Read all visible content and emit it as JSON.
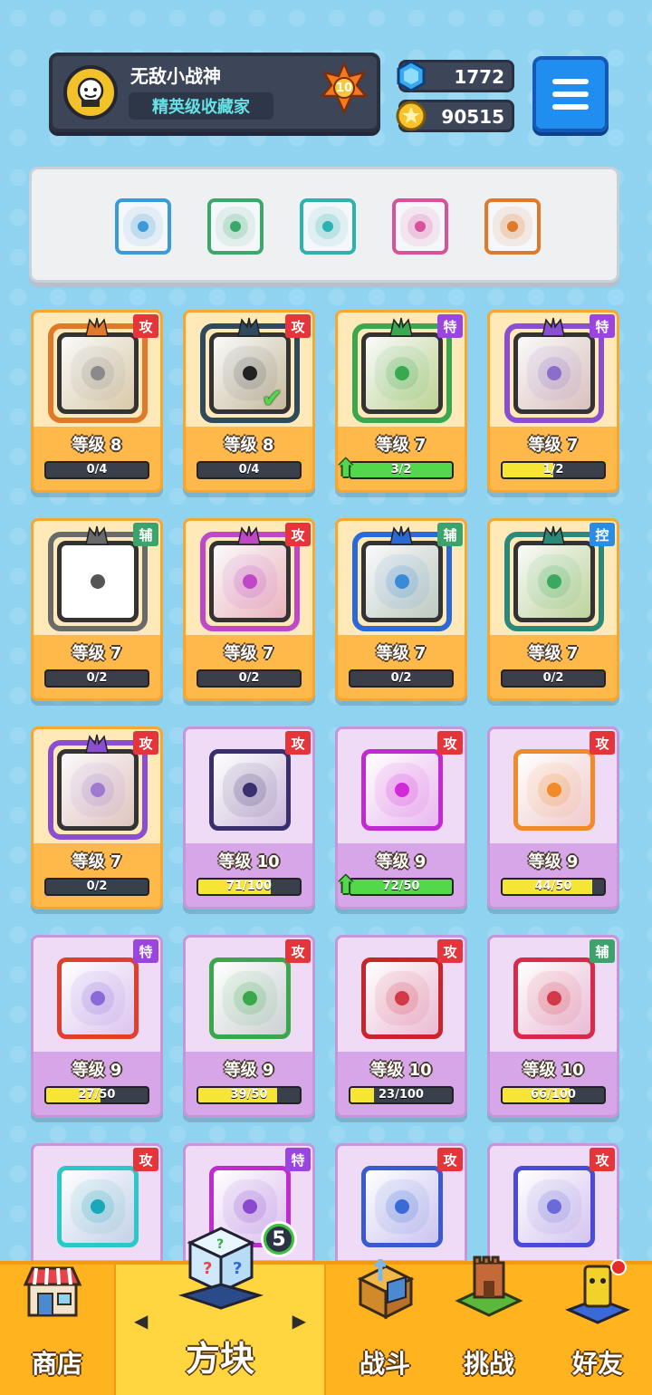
{
  "profile": {
    "name": "无敌小战神",
    "title": "精英级收藏家",
    "rank": "10"
  },
  "currency": {
    "gems": "1772",
    "coins": "90515"
  },
  "deck": [
    {
      "icon": "vortex-icon",
      "color": "#3b9bd8"
    },
    {
      "icon": "pentagram-icon",
      "color": "#3aa86a"
    },
    {
      "icon": "hands-icon",
      "color": "#2ab3b0"
    },
    {
      "icon": "cross-icon",
      "color": "#d8529a"
    },
    {
      "icon": "infinity-icon",
      "color": "#e07a2a"
    }
  ],
  "cards": [
    {
      "tag": "攻",
      "type": "atk",
      "rarity": "legend",
      "level": "等级 8",
      "progress": "0/4",
      "ratio": 0,
      "color": "#8a8a8a",
      "dragon": "#e07a2a",
      "icon": "pistol-icon",
      "upgrade": false,
      "equipped": false
    },
    {
      "tag": "攻",
      "type": "atk",
      "rarity": "legend",
      "level": "等级 8",
      "progress": "0/4",
      "ratio": 0,
      "color": "#555c66",
      "dragon": "#2f4a5c",
      "icon": "black-hole-icon",
      "upgrade": false,
      "equipped": true
    },
    {
      "tag": "特",
      "type": "spe",
      "rarity": "legend",
      "level": "等级 7",
      "progress": "3/2",
      "ratio": 1,
      "color": "#3aa850",
      "dragon": "#3aa850",
      "icon": "vine-icon",
      "upgrade": true,
      "equipped": false
    },
    {
      "tag": "特",
      "type": "spe",
      "rarity": "legend",
      "level": "等级 7",
      "progress": "1/2",
      "ratio": 0.5,
      "color": "#8a6ec9",
      "dragon": "#8a4fd0",
      "icon": "mist-icon",
      "upgrade": false,
      "equipped": false
    },
    {
      "tag": "辅",
      "type": "sup",
      "rarity": "legend",
      "level": "等级 7",
      "progress": "0/2",
      "ratio": 0,
      "color": "#555",
      "dragon": "#6a6a6a",
      "icon": "clock-icon",
      "upgrade": false,
      "equipped": false
    },
    {
      "tag": "攻",
      "type": "atk",
      "rarity": "legend",
      "level": "等级 7",
      "progress": "0/2",
      "ratio": 0,
      "color": "#c048c8",
      "dragon": "#c048c8",
      "icon": "combo-icon",
      "upgrade": false,
      "equipped": false
    },
    {
      "tag": "辅",
      "type": "sup",
      "rarity": "legend",
      "level": "等级 7",
      "progress": "0/2",
      "ratio": 0,
      "color": "#3a8ad8",
      "dragon": "#2a6ad8",
      "icon": "moon-icon",
      "upgrade": false,
      "equipped": false
    },
    {
      "tag": "控",
      "type": "ctl",
      "rarity": "legend",
      "level": "等级 7",
      "progress": "0/2",
      "ratio": 0,
      "color": "#3aa860",
      "dragon": "#2a8a7a",
      "icon": "wind-icon",
      "upgrade": false,
      "equipped": false
    },
    {
      "tag": "攻",
      "type": "atk",
      "rarity": "legend",
      "level": "等级 7",
      "progress": "0/2",
      "ratio": 0,
      "color": "#a07ad0",
      "dragon": "#8a4fd0",
      "icon": "star-icon",
      "upgrade": false,
      "equipped": false
    },
    {
      "tag": "攻",
      "type": "atk",
      "rarity": "epic",
      "level": "等级 10",
      "progress": "71/100",
      "ratio": 0.71,
      "color": "#3a2f6e",
      "frame": "#3a2f6e",
      "icon": "slash-icon",
      "upgrade": false,
      "equipped": false
    },
    {
      "tag": "攻",
      "type": "atk",
      "rarity": "epic",
      "level": "等级 9",
      "progress": "72/50",
      "ratio": 1,
      "color": "#d22ad8",
      "frame": "#c02ad0",
      "icon": "sparkle-icon",
      "upgrade": true,
      "equipped": false
    },
    {
      "tag": "攻",
      "type": "atk",
      "rarity": "epic",
      "level": "等级 9",
      "progress": "44/50",
      "ratio": 0.88,
      "color": "#f08a2a",
      "frame": "#f08a2a",
      "icon": "target-icon",
      "upgrade": false,
      "equipped": false
    },
    {
      "tag": "特",
      "type": "spe",
      "rarity": "epic",
      "level": "等级 9",
      "progress": "27/50",
      "ratio": 0.54,
      "color": "#8a6ad8",
      "frame": "#e0402a",
      "icon": "rainbow-icon",
      "upgrade": false,
      "equipped": false
    },
    {
      "tag": "攻",
      "type": "atk",
      "rarity": "epic",
      "level": "等级 9",
      "progress": "39/50",
      "ratio": 0.78,
      "color": "#3aa84a",
      "frame": "#3aa84a",
      "icon": "biohazard-icon",
      "upgrade": false,
      "equipped": false
    },
    {
      "tag": "攻",
      "type": "atk",
      "rarity": "epic",
      "level": "等级 10",
      "progress": "23/100",
      "ratio": 0.23,
      "color": "#d23a4a",
      "frame": "#c8242a",
      "icon": "lightning-icon",
      "upgrade": false,
      "equipped": false
    },
    {
      "tag": "辅",
      "type": "sup",
      "rarity": "epic",
      "level": "等级 10",
      "progress": "66/100",
      "ratio": 0.66,
      "color": "#d23a4a",
      "frame": "#d82a4a",
      "icon": "heal-plus-icon",
      "upgrade": false,
      "equipped": false
    },
    {
      "tag": "攻",
      "type": "atk",
      "rarity": "epic",
      "level": "",
      "progress": "",
      "ratio": 0,
      "color": "#1aa8b8",
      "frame": "#2ac8c8",
      "icon": "swirl-icon",
      "upgrade": false,
      "equipped": false
    },
    {
      "tag": "特",
      "type": "spe",
      "rarity": "epic",
      "level": "",
      "progress": "",
      "ratio": 0,
      "color": "#8a4ad0",
      "frame": "#c02ad0",
      "icon": "arrow-icon",
      "upgrade": false,
      "equipped": false
    },
    {
      "tag": "攻",
      "type": "atk",
      "rarity": "epic",
      "level": "",
      "progress": "",
      "ratio": 0,
      "color": "#3a6ad8",
      "frame": "#3a5ad0",
      "icon": "gear-icon",
      "upgrade": false,
      "equipped": false
    },
    {
      "tag": "攻",
      "type": "atk",
      "rarity": "epic",
      "level": "",
      "progress": "",
      "ratio": 0,
      "color": "#6a6ad8",
      "frame": "#4a4ad8",
      "icon": "eye-icon",
      "upgrade": false,
      "equipped": false
    }
  ],
  "nav": {
    "shop": "商店",
    "blocks": "方块",
    "battle": "战斗",
    "challenge": "挑战",
    "friends": "好友",
    "blocks_badge": "5"
  }
}
